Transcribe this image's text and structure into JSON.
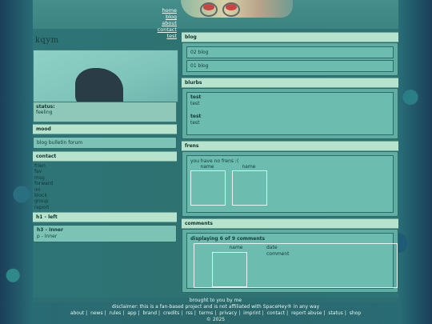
{
  "nav": {
    "links": [
      "home",
      "blog",
      "about",
      "contact",
      "test"
    ]
  },
  "profile": {
    "username": "kqym",
    "status_label": "status:",
    "status_value": "feeling",
    "mood_label": "mood",
    "mood_link": "blog bulletin forum"
  },
  "contact": {
    "title": "contact",
    "links": [
      "frien",
      "fav",
      "msg",
      "forward",
      "im",
      "block",
      "group",
      "report"
    ]
  },
  "h1_left": {
    "title": "h1 - left",
    "h3": "h3 - Inner",
    "p": "p - Inner"
  },
  "blog": {
    "title": "blog",
    "entries": [
      "02 blog",
      "01 blog"
    ]
  },
  "blurbs": {
    "title": "blurbs",
    "lines": [
      "test",
      "test",
      "test",
      "test"
    ]
  },
  "frens": {
    "title": "frens",
    "message": "you have no frens :(",
    "names": [
      "name",
      "name"
    ]
  },
  "comments": {
    "title": "comments",
    "subtitle": "displaying 6 of 9 comments",
    "name": "name",
    "date": "date",
    "comment": "comment"
  },
  "footer": {
    "brought": "brought to you by me",
    "disclaimer": "disclaimer: this is a fan-based project and is not affiliated with SpaceHey® in any way",
    "links": [
      "about",
      "news",
      "rules",
      "app",
      "brand",
      "credits",
      "rss",
      "terms",
      "privacy",
      "imprint",
      "contact",
      "report abuse",
      "status",
      "shop"
    ],
    "year": "© 2025"
  }
}
